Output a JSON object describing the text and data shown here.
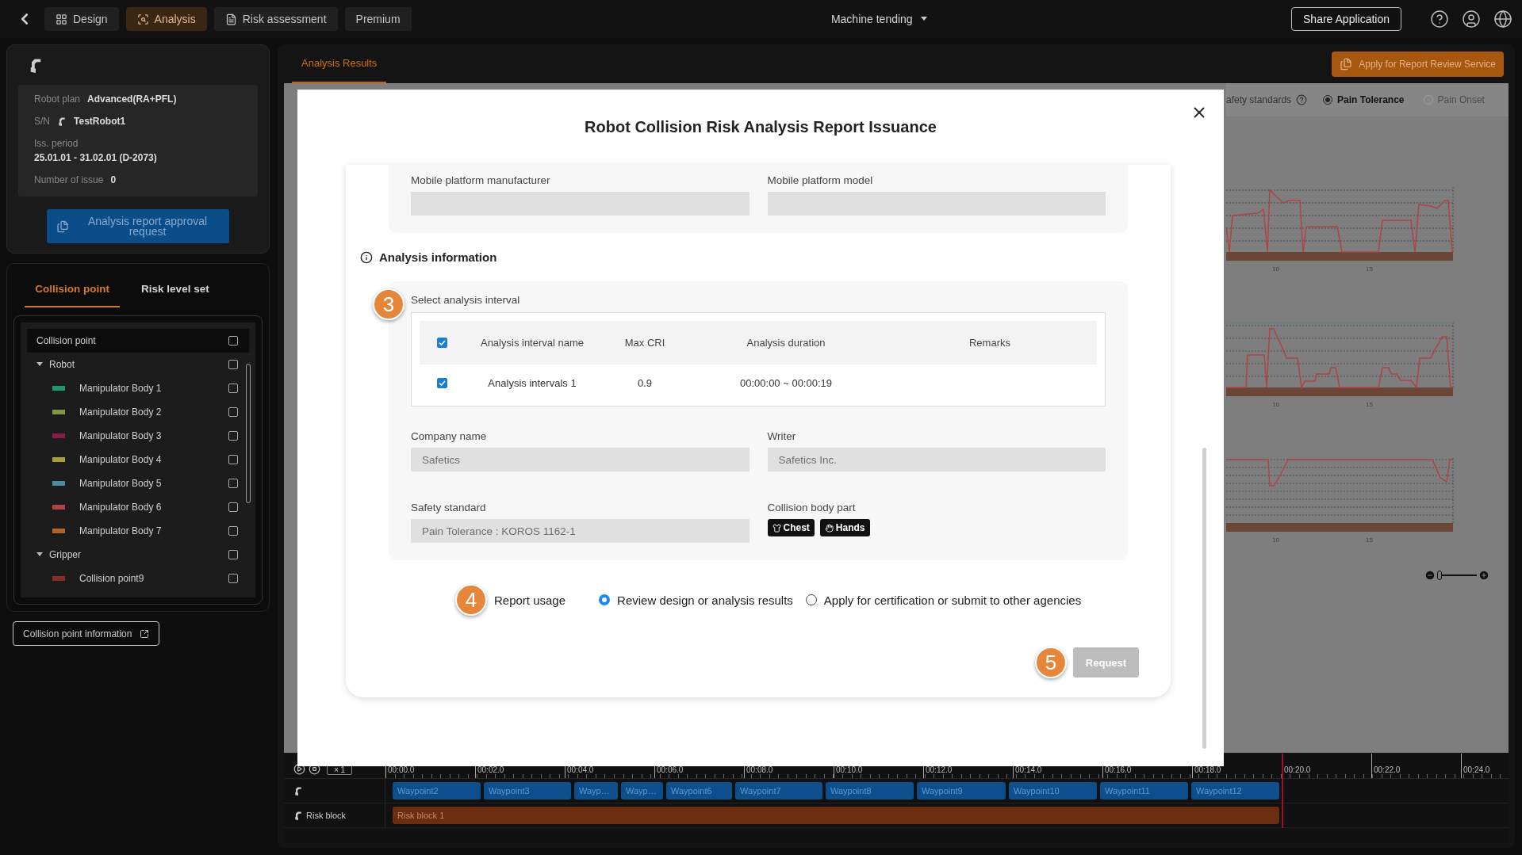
{
  "top_bar": {
    "tabs": [
      {
        "label": "Design",
        "kind": "design",
        "selected": false
      },
      {
        "label": "Analysis",
        "kind": "analysis",
        "selected": true
      },
      {
        "label": "Risk assessment",
        "kind": "document",
        "selected": false
      },
      {
        "label": "Premium",
        "kind": "plain",
        "selected": false
      }
    ],
    "project": "Machine tending",
    "share_button": "Share Application"
  },
  "robot_card": {
    "fields": [
      {
        "kind": "inline",
        "label": "Robot plan",
        "value": "Advanced(RA+PFL)"
      },
      {
        "kind": "robot",
        "label": "S/N",
        "value": "TestRobot1"
      },
      {
        "kind": "stacked",
        "label": "Iss. period",
        "value": "25.01.01 - 31.02.01 (D-2073)"
      },
      {
        "kind": "inline",
        "label": "Number of issue",
        "value": "0"
      }
    ],
    "approval_button": "Analysis report approval request"
  },
  "collision_panel": {
    "tabs": [
      {
        "label": "Collision point",
        "selected": true
      },
      {
        "label": "Risk level set",
        "selected": false
      }
    ],
    "tree": {
      "header": {
        "label": "Collision point",
        "checked": false
      },
      "groups": [
        {
          "label": "Robot",
          "expanded": true,
          "checked": false,
          "children": [
            {
              "label": "Manipulator Body 1",
              "color": "#1a9a6c",
              "checked": false
            },
            {
              "label": "Manipulator Body 2",
              "color": "#7c9a42",
              "checked": false
            },
            {
              "label": "Manipulator Body 3",
              "color": "#8a1a48",
              "checked": false
            },
            {
              "label": "Manipulator Body 4",
              "color": "#a8a032",
              "checked": false
            },
            {
              "label": "Manipulator Body 5",
              "color": "#4a8ca2",
              "checked": false
            },
            {
              "label": "Manipulator Body 6",
              "color": "#b04242",
              "checked": false
            },
            {
              "label": "Manipulator Body 7",
              "color": "#b86222",
              "checked": false
            }
          ]
        },
        {
          "label": "Gripper",
          "expanded": true,
          "checked": false,
          "children": [
            {
              "label": "Collision point9",
              "color": "#8a2a2a",
              "checked": false
            }
          ]
        }
      ]
    },
    "info_button": "Collision point information"
  },
  "main": {
    "tabs": [
      {
        "label": "Analysis Results",
        "selected": true
      }
    ],
    "apply_button": "Apply for Report Review Service",
    "safety_standards": {
      "label": "afety standards",
      "options": [
        {
          "label": "Pain Tolerance",
          "selected": true,
          "disabled": false
        },
        {
          "label": "Pain Onset",
          "selected": false,
          "disabled": true
        }
      ]
    },
    "charts": [
      {
        "kind": "force",
        "x_tick_labels": [
          "10",
          "15"
        ]
      },
      {
        "kind": "pressure",
        "x_tick_labels": [
          "10",
          "15"
        ]
      },
      {
        "kind": "margin",
        "x_tick_labels": [
          "10",
          "15"
        ]
      }
    ],
    "zoom": {
      "level": 0
    }
  },
  "timeline": {
    "speed": "× 1",
    "ticks": [
      "00:00.0",
      "00:02.0",
      "00:04.0",
      "00:06.0",
      "00:08.0",
      "00:10.0",
      "00:12.0",
      "00:14.0",
      "00:16.0",
      "00:18.0",
      "00:20.0",
      "00:22.0",
      "00:24.0"
    ],
    "tracks": [
      {
        "kind": "waypoints",
        "blocks": [
          "Waypoint2",
          "Waypoint3",
          "Wayp…",
          "Wayp…",
          "Waypoint6",
          "Waypoint7",
          "Waypoint8",
          "Waypoint9",
          "Waypoint10",
          "Waypoint11",
          "Waypoint12"
        ]
      },
      {
        "kind": "risk",
        "label": "Risk block",
        "blocks": [
          "Risk block 1"
        ]
      }
    ]
  },
  "dialog": {
    "title": "Robot Collision Risk Analysis Report Issuance",
    "platform_fields": [
      {
        "label": "Mobile platform manufacturer"
      },
      {
        "label": "Mobile platform model"
      }
    ],
    "analysis_heading": "Analysis information",
    "interval": {
      "step": "3",
      "label": "Select analysis interval",
      "table": {
        "all_checked": true,
        "columns": [
          "Analysis interval name",
          "Max CRI",
          "Analysis duration",
          "Remarks"
        ],
        "rows": [
          {
            "checked": true,
            "cells": [
              "Analysis intervals 1",
              "0.9",
              "00:00:00 ~ 00:00:19"
            ]
          }
        ]
      }
    },
    "fields": [
      {
        "kind": "input",
        "label": "Company name",
        "value": "Safetics"
      },
      {
        "kind": "input",
        "label": "Writer",
        "value": "Safetics Inc."
      },
      {
        "kind": "input",
        "label": "Safety standard",
        "value": "Pain Tolerance : KOROS 1162-1"
      },
      {
        "kind": "tags",
        "label": "Collision body part",
        "tags": [
          {
            "label": "Chest",
            "kind": "chest"
          },
          {
            "label": "Hands",
            "kind": "hand"
          }
        ]
      }
    ],
    "usage": {
      "step": "4",
      "label": "Report usage",
      "options": [
        {
          "label": "Review design or analysis results",
          "selected": true
        },
        {
          "label": "Apply for certification or submit to other agencies",
          "selected": false
        }
      ]
    },
    "request": {
      "step": "5",
      "label": "Request",
      "disabled": true
    }
  }
}
